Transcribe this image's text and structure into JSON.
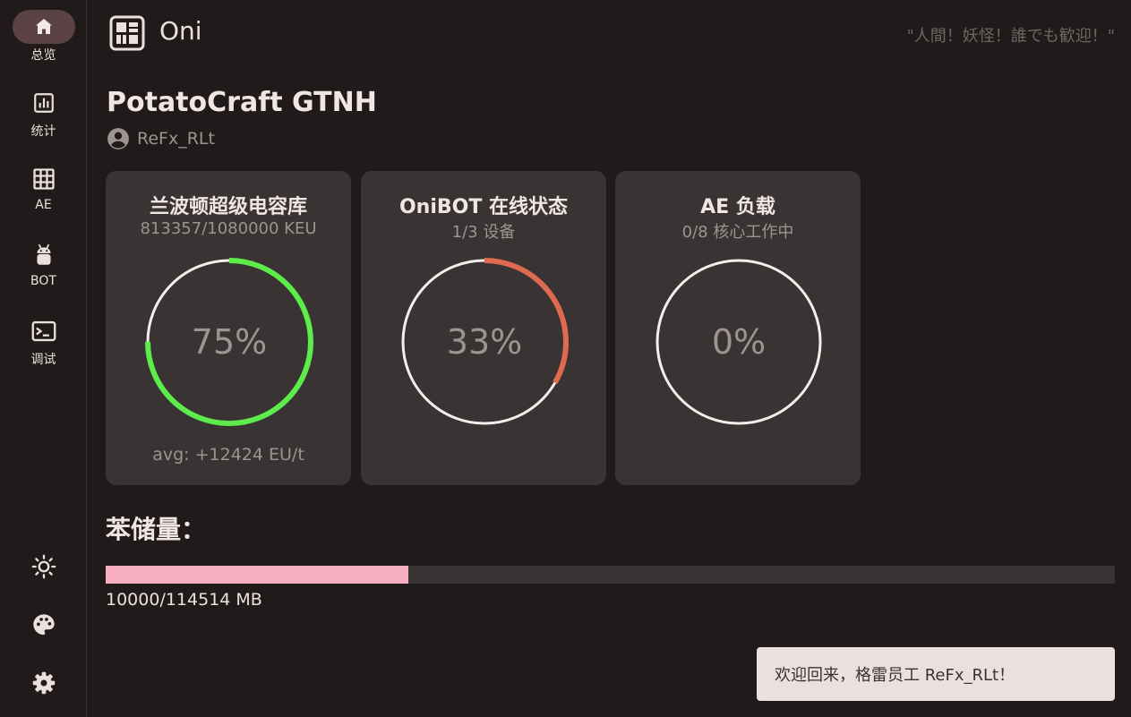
{
  "nav": {
    "items": [
      {
        "label": "总览",
        "icon": "home-icon",
        "active": true
      },
      {
        "label": "统计",
        "icon": "chart-icon",
        "active": false
      },
      {
        "label": "AE",
        "icon": "grid-icon",
        "active": false
      },
      {
        "label": "BOT",
        "icon": "android-icon",
        "active": false
      },
      {
        "label": "调试",
        "icon": "terminal-icon",
        "active": false
      }
    ],
    "bottom": [
      "sun-icon",
      "palette-icon",
      "gear-icon"
    ]
  },
  "header": {
    "app_title": "Oni",
    "quote": "\"人間！妖怪！誰でも歓迎！\""
  },
  "server": {
    "title": "PotatoCraft GTNH",
    "user": "ReFx_RLt"
  },
  "cards": [
    {
      "title": "兰波顿超级电容库",
      "subtitle": "813357/1080000 KEU",
      "percent_label": "75%",
      "percent": 0.75,
      "color": "#5ced4a",
      "footer": "avg: +12424 EU/t"
    },
    {
      "title": "OniBOT 在线状态",
      "subtitle": "1/3 设备",
      "percent_label": "33%",
      "percent": 0.333,
      "color": "#e06a4f",
      "footer": ""
    },
    {
      "title": "AE 负载",
      "subtitle": "0/8 核心工作中",
      "percent_label": "0%",
      "percent": 0,
      "color": "#e06a4f",
      "footer": ""
    }
  ],
  "storage": {
    "title": "苯储量：",
    "text": "10000/114514 MB",
    "fraction": 0.3,
    "color": "#f7aec3"
  },
  "toast": {
    "message": "欢迎回来，格雷员工 ReFx_RLt！"
  }
}
